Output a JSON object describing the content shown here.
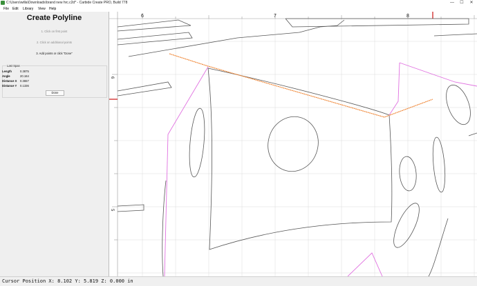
{
  "window": {
    "title": "C:\\Users\\willa\\Downloads\\brand new hrc.c2d* - Carbide Create PRO, Build 778",
    "controls": [
      "—",
      "☐",
      "✕"
    ]
  },
  "menu": [
    "File",
    "Edit",
    "Library",
    "View",
    "Help"
  ],
  "panel": {
    "title": "Create Polyline",
    "steps": [
      "1. Click on first point",
      "2. Click on additional points",
      "3. Add points or click \"Done\""
    ],
    "last_span": {
      "title": "Last Span",
      "rows": [
        {
          "label": "Length",
          "value": "0.3875"
        },
        {
          "label": "Angle",
          "value": "20.164"
        },
        {
          "label": "Distance X",
          "value": "0.3657"
        },
        {
          "label": "Distance Y",
          "value": "0.1336"
        }
      ]
    },
    "done_label": "Done"
  },
  "canvas": {
    "ruler_x": [
      "6",
      "7",
      "8"
    ],
    "ruler_y": [
      "6",
      "5"
    ],
    "colors": {
      "polyline": "#f08a3c",
      "selected": "#e070e0",
      "vector": "#555555",
      "marker": "#cc1111",
      "grid": "#dadada"
    }
  },
  "status": {
    "text": "Cursor Position X: 8.102 Y: 5.819 Z: 0.000 in"
  }
}
